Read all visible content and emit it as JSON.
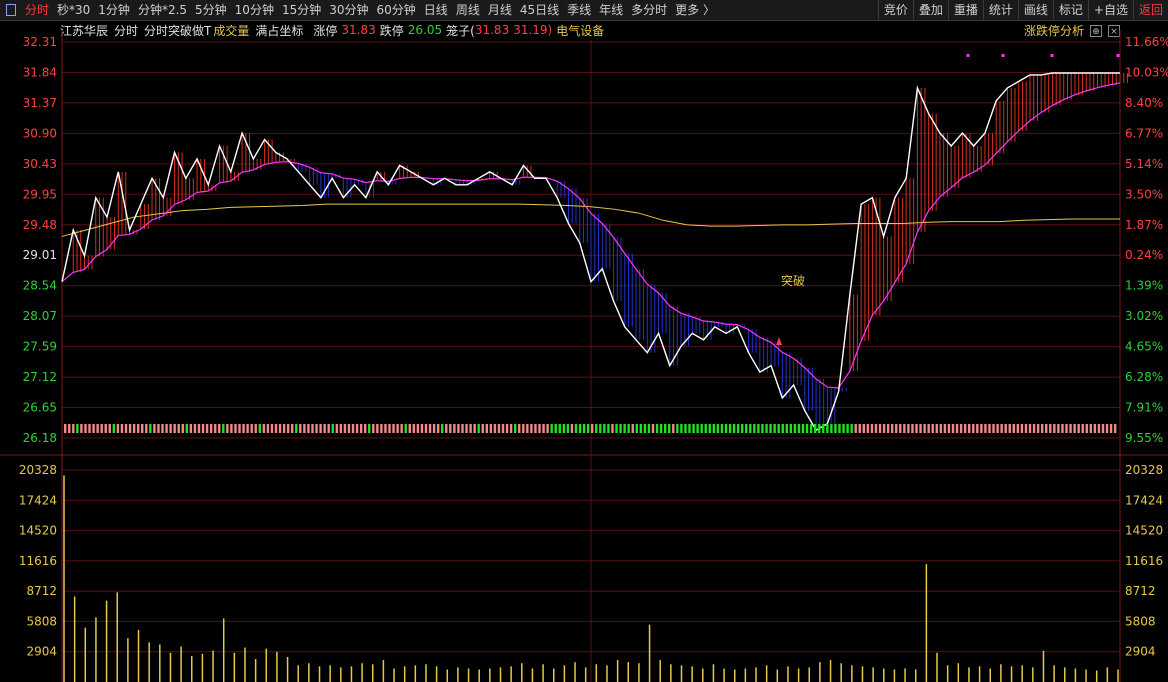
{
  "toolbar": {
    "items": [
      "分时",
      "秒*30",
      "1分钟",
      "分钟*2.5",
      "5分钟",
      "10分钟",
      "15分钟",
      "30分钟",
      "60分钟",
      "日线",
      "周线",
      "月线",
      "45日线",
      "季线",
      "年线",
      "多分时",
      "更多 〉"
    ],
    "right_items": [
      "竞价",
      "叠加",
      "重播",
      "统计",
      "画线",
      "标记",
      "+自选",
      "返回"
    ]
  },
  "info": {
    "stock_name": "江苏华辰",
    "mode": "分时",
    "indicator": "分时突破做T",
    "volume_label": "成交量",
    "coord_label": "满占坐标",
    "limit_up_label": "涨停",
    "limit_up_value": "31.83",
    "limit_down_label": "跌停",
    "limit_down_value": "26.05",
    "cage_label": "笼子(",
    "cage_high": "31.83",
    "cage_low": "31.19)",
    "sector": "电气设备",
    "analysis_btn": "涨跌停分析",
    "breakout_label": "突破"
  },
  "price_axis": {
    "left": [
      "32.31",
      "31.84",
      "31.37",
      "30.90",
      "30.43",
      "29.95",
      "29.48",
      "29.01",
      "28.54",
      "28.07",
      "27.59",
      "27.12",
      "26.65",
      "26.18"
    ],
    "right": [
      "11.66%",
      "10.03%",
      "8.40%",
      "6.77%",
      "5.14%",
      "3.50%",
      "1.87%",
      "0.24%",
      "1.39%",
      "3.02%",
      "4.65%",
      "6.28%",
      "7.91%",
      "9.55%"
    ],
    "right_colors": [
      "red",
      "red",
      "red",
      "red",
      "red",
      "red",
      "red",
      "red",
      "green",
      "green",
      "green",
      "green",
      "green",
      "green"
    ]
  },
  "volume_axis": {
    "labels": [
      "20328",
      "17424",
      "14520",
      "11616",
      "8712",
      "5808",
      "2904"
    ]
  },
  "colors": {
    "up": "#ff4040",
    "down": "#2fd03a",
    "price_line": "#ffffff",
    "avg_line": "#e6c84a",
    "ma_line": "#ff33ff",
    "grid": "#5a1010",
    "fill_up": "#d23020",
    "fill_down": "#2233cc",
    "volume_bar": "#e6c84a"
  },
  "chart_data": {
    "type": "line",
    "series": [
      {
        "values": [
          28.6,
          29.4,
          29.0,
          29.9,
          29.6,
          30.3,
          29.4,
          29.8,
          30.2,
          29.9,
          30.6,
          30.2,
          30.5,
          30.1,
          30.7,
          30.3,
          30.9,
          30.5,
          30.8,
          30.6,
          30.5,
          30.3,
          30.1,
          29.9,
          30.2,
          29.9,
          30.1,
          29.9,
          30.3,
          30.1,
          30.4,
          30.3,
          30.2,
          30.1,
          30.2,
          30.1,
          30.1,
          30.2,
          30.3,
          30.2,
          30.1,
          30.4,
          30.2,
          30.2,
          29.9,
          29.5,
          29.2,
          28.6,
          28.8,
          28.3,
          27.9,
          27.7,
          27.5,
          27.8,
          27.3,
          27.6,
          27.8,
          27.7,
          27.9,
          27.8,
          27.9,
          27.5,
          27.2,
          27.3,
          26.8,
          27.0,
          26.6,
          26.3,
          26.4,
          26.9,
          28.4,
          29.8,
          29.9,
          29.3,
          29.9,
          30.2,
          31.6,
          31.2,
          30.9,
          30.7,
          30.9,
          30.7,
          30.9,
          31.4,
          31.6,
          31.7,
          31.8,
          31.8,
          31.83,
          31.83,
          31.83,
          31.83,
          31.83,
          31.83,
          31.83
        ]
      },
      {
        "values": [
          29.3,
          29.4,
          29.5,
          29.6,
          29.65,
          29.7,
          29.72,
          29.75,
          29.76,
          29.77,
          29.78,
          29.8,
          29.8,
          29.8,
          29.8,
          29.8,
          29.8,
          29.8,
          29.8,
          29.8,
          29.79,
          29.78,
          29.76,
          29.72,
          29.66,
          29.55,
          29.48,
          29.46,
          29.46,
          29.47,
          29.48,
          29.48,
          29.49,
          29.5,
          29.5,
          29.5,
          29.52,
          29.53,
          29.53,
          29.53,
          29.55,
          29.56,
          29.57,
          29.57,
          29.57
        ]
      }
    ],
    "ylim": [
      26.18,
      32.31
    ],
    "volume": [
      19800,
      8200,
      5200,
      6200,
      7800,
      8600,
      4200,
      5000,
      3800,
      3600,
      2800,
      3400,
      2500,
      2700,
      3000,
      6100,
      2800,
      3300,
      2200,
      3200,
      2900,
      2400,
      1600,
      1800,
      1500,
      1600,
      1400,
      1500,
      1800,
      1700,
      2100,
      1300,
      1500,
      1600,
      1700,
      1500,
      1200,
      1400,
      1300,
      1200,
      1300,
      1400,
      1500,
      1800,
      1300,
      1700,
      1300,
      1600,
      1900,
      1400,
      1700,
      1600,
      2100,
      1900,
      1800,
      5500,
      2100,
      1700,
      1600,
      1500,
      1300,
      1700,
      1300,
      1200,
      1300,
      1400,
      1600,
      1200,
      1500,
      1300,
      1400,
      1900,
      2100,
      1800,
      1600,
      1500,
      1400,
      1300,
      1200,
      1300,
      1200,
      11300,
      2800,
      1600,
      1800,
      1400,
      1500,
      1300,
      1700,
      1500,
      1600,
      1400,
      3000,
      1600,
      1400,
      1300,
      1200,
      1100,
      1400,
      1200
    ]
  }
}
